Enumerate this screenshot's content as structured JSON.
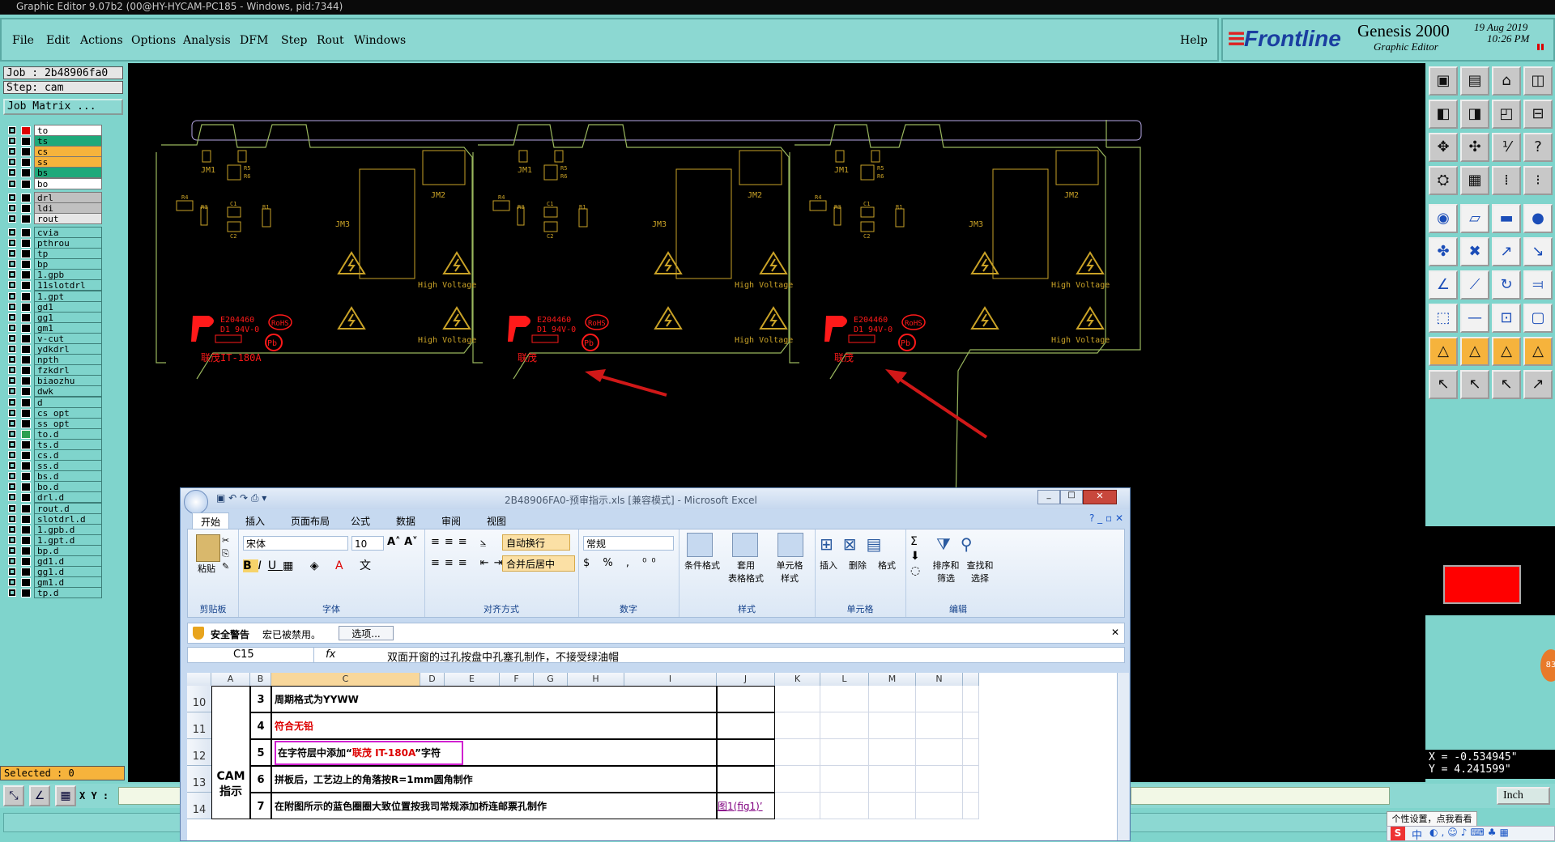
{
  "window": {
    "title": "Graphic Editor 9.07b2 (00@HY-HYCAM-PC185 - Windows, pid:7344)"
  },
  "menu": {
    "items": [
      "File",
      "Edit",
      "Actions",
      "Options",
      "Analysis",
      "DFM",
      "Step",
      "Rout",
      "Windows"
    ],
    "help": "Help"
  },
  "brand": {
    "logo": "Frontline",
    "product": "Genesis 2000",
    "subtitle": "Graphic Editor",
    "date": "19 Aug 2019",
    "time": "10:26 PM"
  },
  "job": {
    "job_label": "Job : 2b48906fa0",
    "step_label": "Step: cam",
    "matrix_button": "Job Matrix ..."
  },
  "layers": [
    {
      "name": "to",
      "color": "#ffffff",
      "selected": true
    },
    {
      "name": "ts",
      "color": "#1ea97a"
    },
    {
      "name": "cs",
      "color": "#f6b33c"
    },
    {
      "name": "ss",
      "color": "#f6b33c"
    },
    {
      "name": "bs",
      "color": "#1ea97a"
    },
    {
      "name": "bo",
      "color": "#ffffff"
    },
    {
      "name": "drl",
      "color": "#c0c0c0"
    },
    {
      "name": "ldi",
      "color": "#c0c0c0"
    },
    {
      "name": "rout",
      "color": "#e6e6e6"
    },
    {
      "name": "cvia",
      "color": "#7fd4cc"
    },
    {
      "name": "pthrou",
      "color": "#7fd4cc"
    },
    {
      "name": "tp",
      "color": "#7fd4cc"
    },
    {
      "name": "bp",
      "color": "#7fd4cc"
    },
    {
      "name": "1.gpb",
      "color": "#7fd4cc"
    },
    {
      "name": "11slotdrl",
      "color": "#7fd4cc"
    },
    {
      "name": "1.gpt",
      "color": "#7fd4cc"
    },
    {
      "name": "gd1",
      "color": "#7fd4cc"
    },
    {
      "name": "gg1",
      "color": "#7fd4cc"
    },
    {
      "name": "gm1",
      "color": "#7fd4cc"
    },
    {
      "name": "v-cut",
      "color": "#7fd4cc"
    },
    {
      "name": "ydkdrl",
      "color": "#7fd4cc"
    },
    {
      "name": "npth",
      "color": "#7fd4cc"
    },
    {
      "name": "fzkdrl",
      "color": "#7fd4cc"
    },
    {
      "name": "biaozhu",
      "color": "#7fd4cc"
    },
    {
      "name": "dwk",
      "color": "#7fd4cc"
    },
    {
      "name": "d",
      "color": "#7fd4cc"
    },
    {
      "name": "cs_opt",
      "color": "#7fd4cc"
    },
    {
      "name": "ss_opt",
      "color": "#7fd4cc"
    },
    {
      "name": "to.d",
      "color": "#7fd4cc"
    },
    {
      "name": "ts.d",
      "color": "#7fd4cc"
    },
    {
      "name": "cs.d",
      "color": "#7fd4cc"
    },
    {
      "name": "ss.d",
      "color": "#7fd4cc"
    },
    {
      "name": "bs.d",
      "color": "#7fd4cc"
    },
    {
      "name": "bo.d",
      "color": "#7fd4cc"
    },
    {
      "name": "drl.d",
      "color": "#7fd4cc"
    },
    {
      "name": "rout.d",
      "color": "#7fd4cc"
    },
    {
      "name": "slotdrl.d",
      "color": "#7fd4cc"
    },
    {
      "name": "1.gpb.d",
      "color": "#7fd4cc"
    },
    {
      "name": "1.gpt.d",
      "color": "#7fd4cc"
    },
    {
      "name": "bp.d",
      "color": "#7fd4cc"
    },
    {
      "name": "gd1.d",
      "color": "#7fd4cc"
    },
    {
      "name": "gg1.d",
      "color": "#7fd4cc"
    },
    {
      "name": "gm1.d",
      "color": "#7fd4cc"
    },
    {
      "name": "tp.d",
      "color": "#7fd4cc"
    }
  ],
  "status": {
    "selected": "Selected : 0",
    "xy_label": "X Y :",
    "coord_x": "X = -0.534945\"",
    "coord_y": "Y = 4.241599\"",
    "units": "Inch"
  },
  "pcb": {
    "silk_labels": [
      "JM1",
      "R5",
      "R6",
      "JM2",
      "JM3",
      "R4",
      "R3",
      "C1",
      "C2",
      "R1",
      "High Voltage",
      "High Voltage"
    ],
    "ul_text": [
      "E204460",
      "D1 94V-0"
    ],
    "rohs": "RoHS",
    "pb": "Pb",
    "marking_first": "联茂IT-180A",
    "marking_other": "联茂"
  },
  "excel": {
    "title": "2B48906FA0-预审指示.xls [兼容模式] - Microsoft Excel",
    "tabs": [
      "开始",
      "插入",
      "页面布局",
      "公式",
      "数据",
      "审阅",
      "视图"
    ],
    "font": "宋体",
    "font_size": "10",
    "wrap": "自动换行",
    "merge": "合并后居中",
    "number_format": "常规",
    "groups": [
      "剪贴板",
      "字体",
      "对齐方式",
      "数字",
      "样式",
      "单元格",
      "编辑"
    ],
    "style_buttons": [
      "条件格式",
      "套用\n表格格式",
      "单元格\n样式"
    ],
    "cell_buttons": [
      "插入",
      "删除",
      "格式"
    ],
    "edit_buttons": [
      "排序和\n筛选",
      "查找和\n选择"
    ],
    "paste": "粘贴",
    "security_title": "安全警告",
    "security_text": "宏已被禁用。",
    "security_button": "选项...",
    "namebox": "C15",
    "formula": "双面开窗的过孔按盘中孔塞孔制作，不接受绿油帽",
    "columns": [
      "A",
      "B",
      "C",
      "D",
      "E",
      "F",
      "G",
      "H",
      "I",
      "J",
      "K",
      "L",
      "M",
      "N"
    ],
    "rows": [
      {
        "num": "10",
        "idx": "3",
        "text": "周期格式为YYWW",
        "extra": ""
      },
      {
        "num": "11",
        "idx": "4",
        "text": "符合无铅",
        "extra": ""
      },
      {
        "num": "12",
        "idx": "5",
        "text_pre": "在字符层中添加“",
        "text_red": "联茂 IT-180A",
        "text_post": "”字符",
        "extra": ""
      },
      {
        "num": "13",
        "idx": "6",
        "text": "拼板后，工艺边上的角落按R=1mm圆角制作",
        "extra": ""
      },
      {
        "num": "14",
        "idx": "7",
        "text": "在附图所示的蓝色圈圈大致位置按我司常规添加桥连邮票孔制作",
        "extra": "图1(fig1)’"
      }
    ],
    "merged_a": "CAM\n指示"
  },
  "ime": {
    "tooltip": "个性设置，点我看看",
    "lang": "中"
  },
  "badge": "83"
}
